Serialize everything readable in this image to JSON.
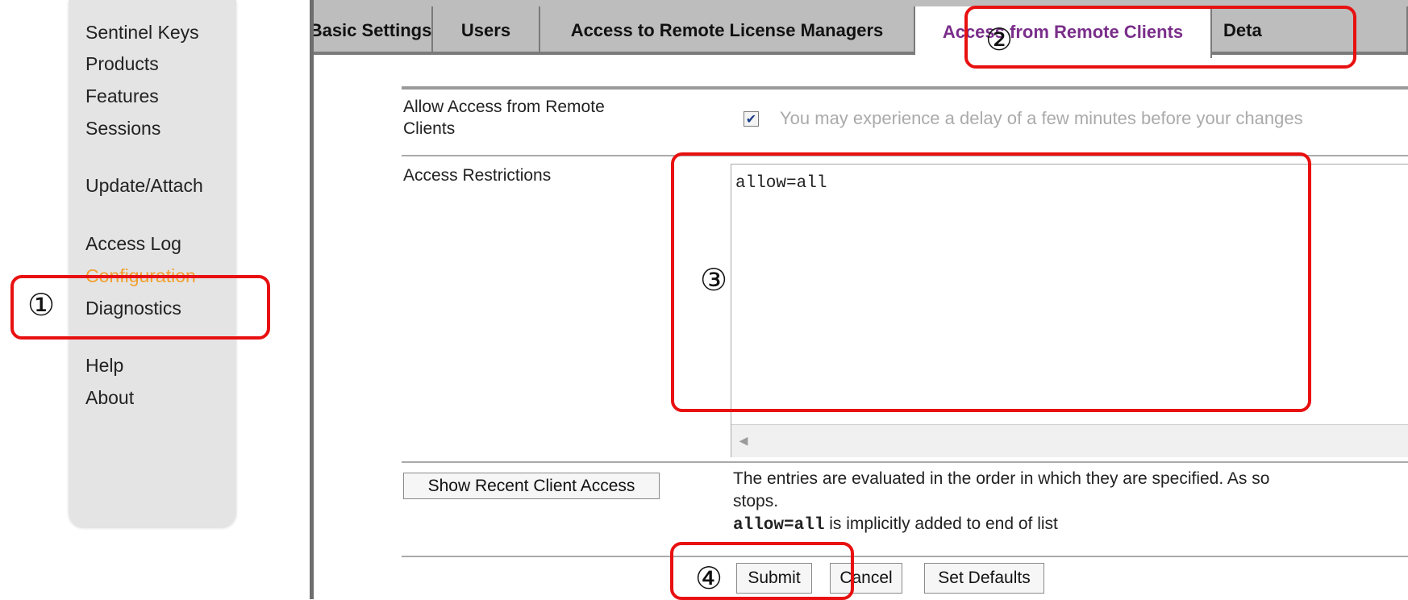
{
  "sidebar": {
    "items": [
      {
        "label": "Sentinel Keys"
      },
      {
        "label": "Products"
      },
      {
        "label": "Features"
      },
      {
        "label": "Sessions"
      },
      {
        "label": "Update/Attach"
      },
      {
        "label": "Access Log"
      },
      {
        "label": "Configuration",
        "active": true
      },
      {
        "label": "Diagnostics"
      },
      {
        "label": "Help"
      },
      {
        "label": "About"
      }
    ]
  },
  "tabs": [
    {
      "label": "Basic Settings"
    },
    {
      "label": "Users"
    },
    {
      "label": "Access to Remote License Managers"
    },
    {
      "label": "Access from Remote Clients",
      "active": true
    },
    {
      "label": "Deta"
    }
  ],
  "form": {
    "allow_access_label_line1": "Allow Access from Remote",
    "allow_access_label_line2": "Clients",
    "allow_access_checked": true,
    "allow_access_notice": "You may experience a delay of a few minutes before your changes",
    "restrictions_label": "Access Restrictions",
    "restrictions_value": "allow=all",
    "show_recent_button": "Show Recent Client Access",
    "explain_line1": "The entries are evaluated in the order in which they are specified. As so",
    "explain_line2": "stops.",
    "explain_code": "allow=all",
    "explain_line3_rest": " is implicitly added to end of list"
  },
  "actions": {
    "submit": "Submit",
    "cancel": "Cancel",
    "set_defaults": "Set Defaults"
  },
  "annotations": {
    "step1": "①",
    "step2": "②",
    "step3": "③",
    "step4": "④",
    "color": "#e81010"
  },
  "colors": {
    "active_nav": "#f0a030",
    "active_tab": "#7a2e8a"
  }
}
